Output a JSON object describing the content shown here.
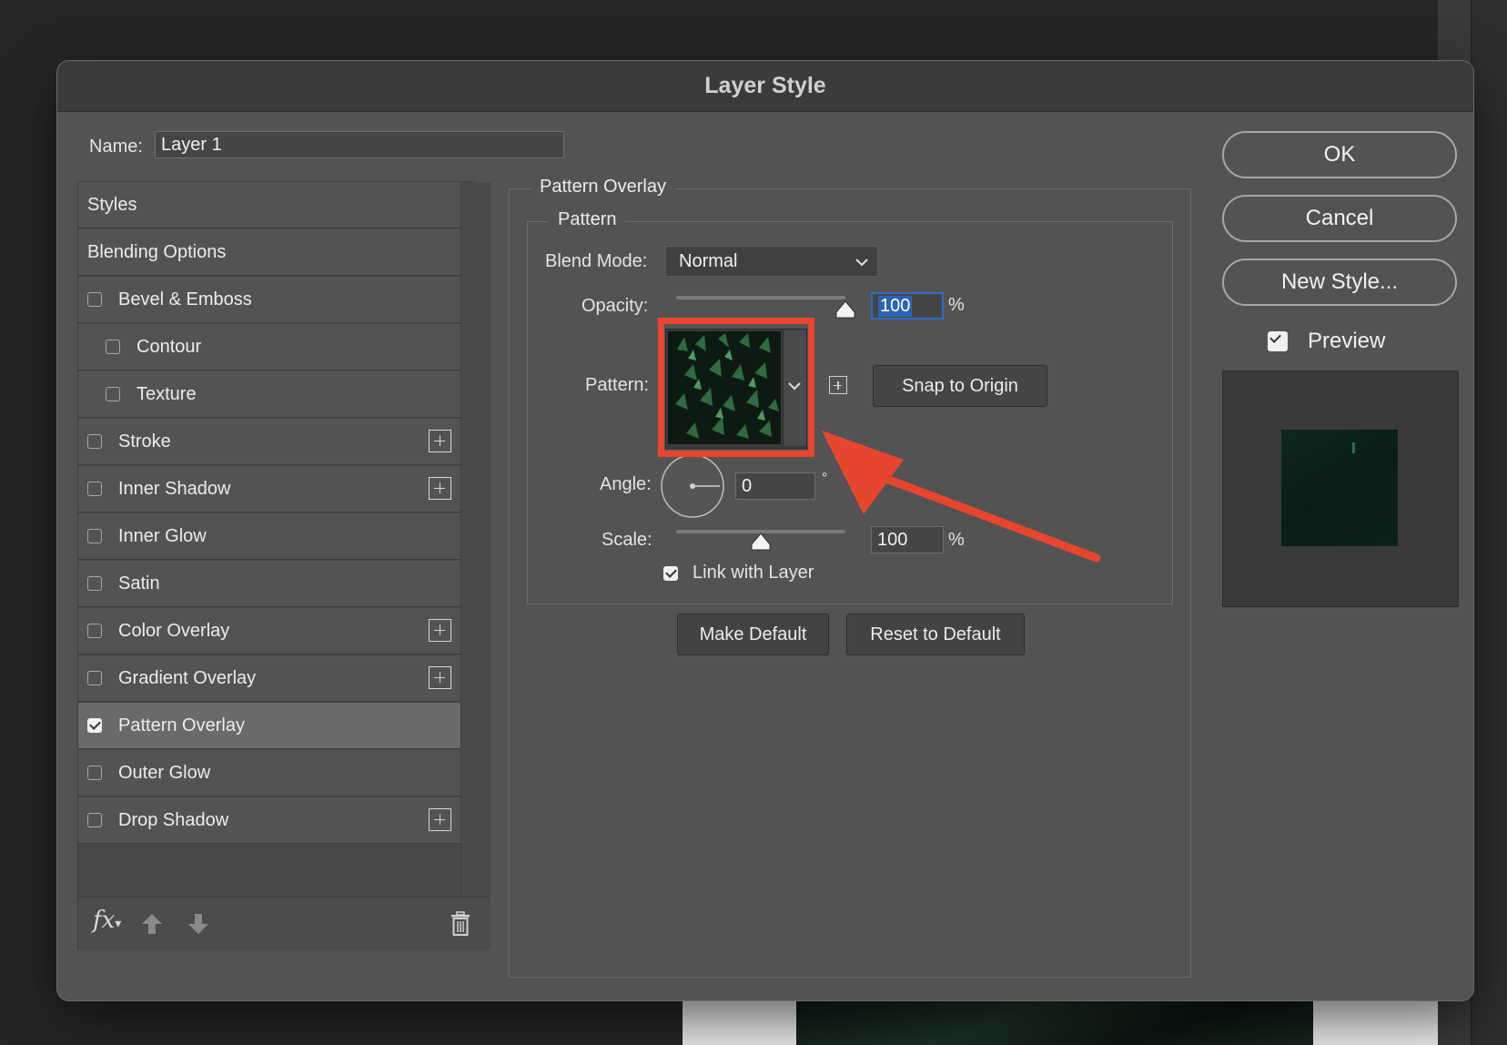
{
  "dialog": {
    "title": "Layer Style"
  },
  "name_field": {
    "label": "Name:",
    "value": "Layer 1"
  },
  "style_list": {
    "items": [
      {
        "label": "Styles",
        "checkbox": false,
        "checked": false,
        "indent": false,
        "add": false,
        "selected": false
      },
      {
        "label": "Blending Options",
        "checkbox": false,
        "checked": false,
        "indent": false,
        "add": false,
        "selected": false
      },
      {
        "label": "Bevel & Emboss",
        "checkbox": true,
        "checked": false,
        "indent": false,
        "add": false,
        "selected": false
      },
      {
        "label": "Contour",
        "checkbox": true,
        "checked": false,
        "indent": true,
        "add": false,
        "selected": false
      },
      {
        "label": "Texture",
        "checkbox": true,
        "checked": false,
        "indent": true,
        "add": false,
        "selected": false
      },
      {
        "label": "Stroke",
        "checkbox": true,
        "checked": false,
        "indent": false,
        "add": true,
        "selected": false
      },
      {
        "label": "Inner Shadow",
        "checkbox": true,
        "checked": false,
        "indent": false,
        "add": true,
        "selected": false
      },
      {
        "label": "Inner Glow",
        "checkbox": true,
        "checked": false,
        "indent": false,
        "add": false,
        "selected": false
      },
      {
        "label": "Satin",
        "checkbox": true,
        "checked": false,
        "indent": false,
        "add": false,
        "selected": false
      },
      {
        "label": "Color Overlay",
        "checkbox": true,
        "checked": false,
        "indent": false,
        "add": true,
        "selected": false
      },
      {
        "label": "Gradient Overlay",
        "checkbox": true,
        "checked": false,
        "indent": false,
        "add": true,
        "selected": false
      },
      {
        "label": "Pattern Overlay",
        "checkbox": true,
        "checked": true,
        "indent": false,
        "add": false,
        "selected": true
      },
      {
        "label": "Outer Glow",
        "checkbox": true,
        "checked": false,
        "indent": false,
        "add": false,
        "selected": false
      },
      {
        "label": "Drop Shadow",
        "checkbox": true,
        "checked": false,
        "indent": false,
        "add": true,
        "selected": false
      }
    ],
    "footer": {
      "fx_label": "fx"
    }
  },
  "panel": {
    "group_title": "Pattern Overlay",
    "subgroup_title": "Pattern",
    "blend_mode": {
      "label": "Blend Mode:",
      "value": "Normal"
    },
    "opacity": {
      "label": "Opacity:",
      "value": "100",
      "unit": "%",
      "level": 1.0
    },
    "pattern": {
      "label": "Pattern:",
      "snap_label": "Snap to Origin"
    },
    "angle": {
      "label": "Angle:",
      "value": "0",
      "unit": "°"
    },
    "scale": {
      "label": "Scale:",
      "value": "100",
      "unit": "%",
      "level": 0.5
    },
    "link_with_layer": {
      "label": "Link with Layer",
      "checked": true
    },
    "make_default_label": "Make Default",
    "reset_default_label": "Reset to Default"
  },
  "actions": {
    "ok_label": "OK",
    "cancel_label": "Cancel",
    "new_style_label": "New Style...",
    "preview_label": "Preview",
    "preview_checked": true
  },
  "annotation": {
    "color": "#e8452f"
  },
  "colors": {
    "highlight": "#1f5fae",
    "selected_row": "#6a6a6a"
  }
}
